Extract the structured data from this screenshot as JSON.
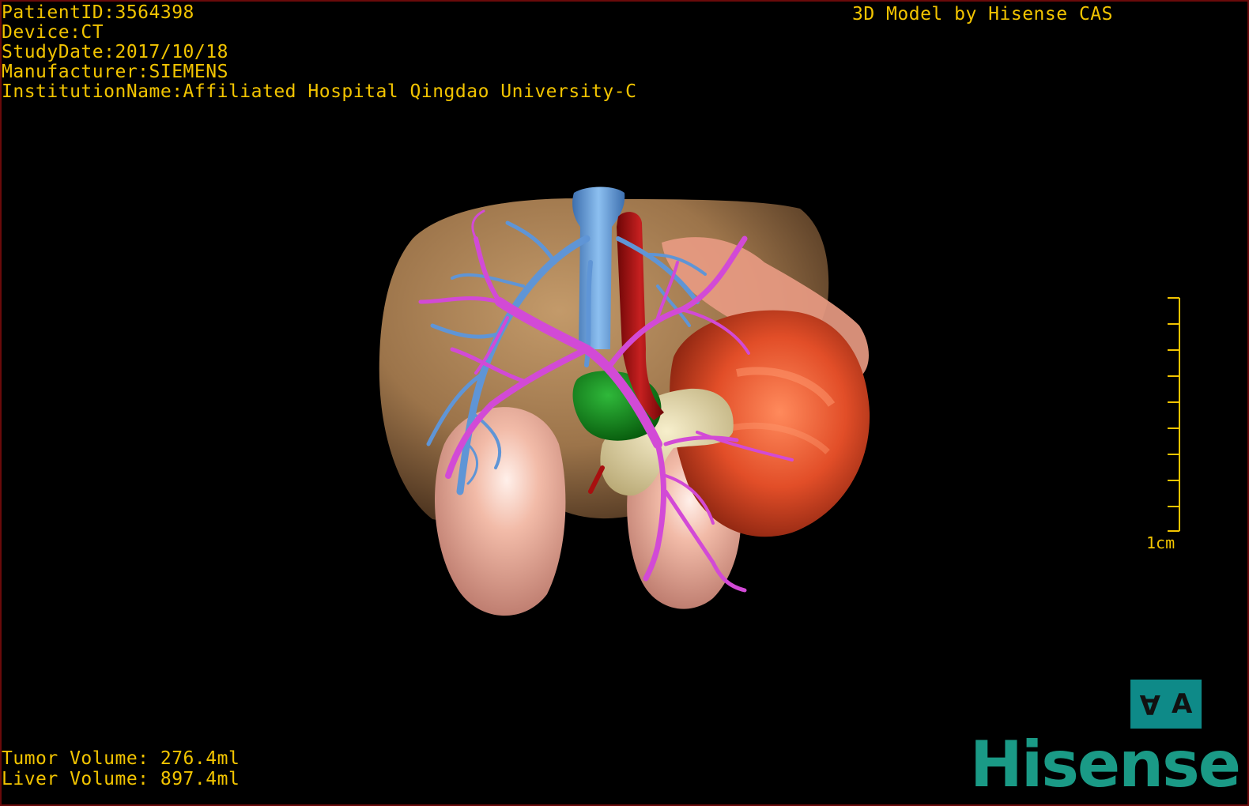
{
  "dicom_info": {
    "patient_id": "PatientID:3564398",
    "device": "Device:CT",
    "study_date": "StudyDate:2017/10/18",
    "manufacturer": "Manufacturer:SIEMENS",
    "institution": "InstitutionName:Affiliated Hospital Qingdao University-C"
  },
  "header": {
    "model_credit": "3D Model by Hisense CAS"
  },
  "volumes": {
    "tumor": "Tumor Volume: 276.4ml",
    "liver": "Liver Volume: 897.4ml"
  },
  "scale": {
    "label": "1cm"
  },
  "orientation_cube": {
    "left_glyph": "A",
    "right_glyph": "A"
  },
  "branding": {
    "logo_text": "Hisense"
  },
  "colors": {
    "overlay_text": "#f2c400",
    "liver": "#a37a4e",
    "tumor": "#e5562e",
    "portal_vein": "#d24ad6",
    "hepatic_vein": "#5f95d6",
    "artery": "#a80f0f",
    "gallbladder": "#0e7a14",
    "pancreas": "#e8dcae",
    "kidney": "#f0b3a0",
    "logo": "#1a9a86",
    "orientation_cube": "#0e8a88"
  }
}
